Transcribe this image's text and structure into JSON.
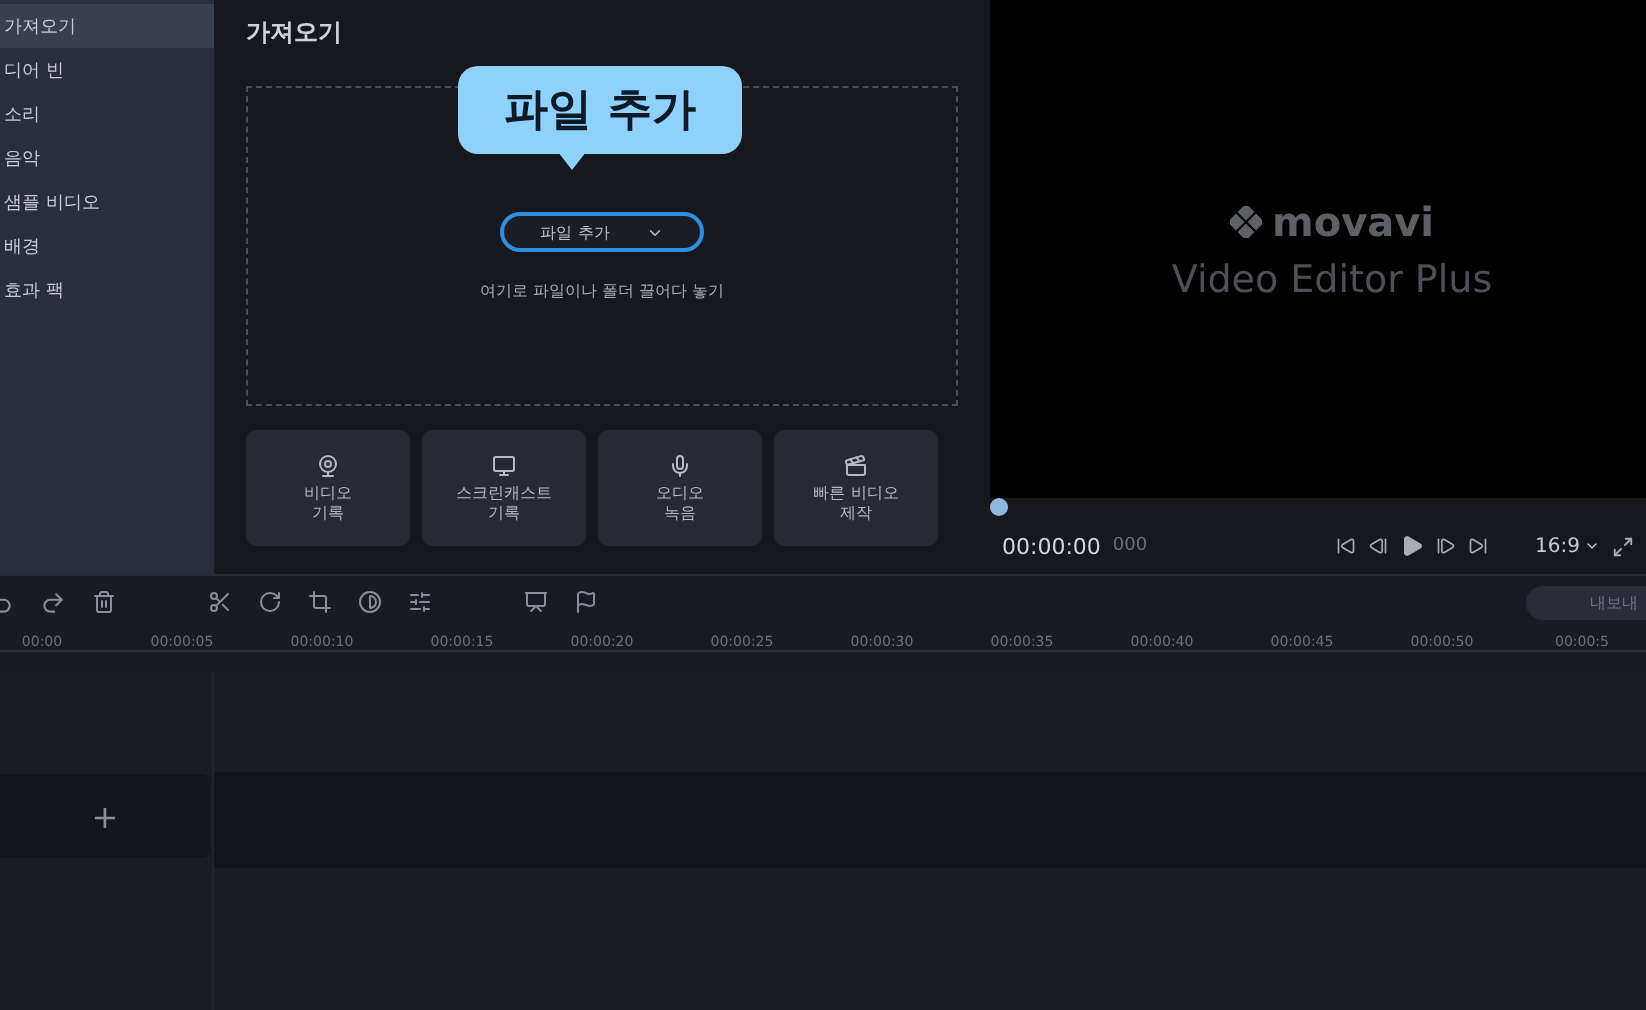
{
  "sidebar": {
    "items": [
      {
        "label": "가져오기",
        "selected": true
      },
      {
        "label": "디어 빈",
        "selected": false
      },
      {
        "label": "소리",
        "selected": false
      },
      {
        "label": "음악",
        "selected": false
      },
      {
        "label": "샘플 비디오",
        "selected": false
      },
      {
        "label": "배경",
        "selected": false
      },
      {
        "label": "효과 팩",
        "selected": false
      }
    ]
  },
  "import_panel": {
    "title": "가져오기",
    "callout": "파일 추가",
    "add_button": "파일 추가",
    "drop_hint": "여기로 파일이나 폴더 끌어다 놓기",
    "actions": [
      {
        "kind": "webcam",
        "lines": [
          "비디오",
          "기록"
        ]
      },
      {
        "kind": "screen",
        "lines": [
          "스크린캐스트",
          "기록"
        ]
      },
      {
        "kind": "mic",
        "lines": [
          "오디오",
          "녹음"
        ]
      },
      {
        "kind": "quick",
        "lines": [
          "빠른 비디오",
          "제작"
        ]
      }
    ]
  },
  "preview": {
    "logo": "movavi",
    "product": "Video Editor Plus",
    "timecode": "00:00:00",
    "milliseconds": "000",
    "aspect": "16:9",
    "level": 0
  },
  "timeline": {
    "export_button": "내보내",
    "ticks": [
      "00:00",
      "00:00:05",
      "00:00:10",
      "00:00:15",
      "00:00:20",
      "00:00:25",
      "00:00:30",
      "00:00:35",
      "00:00:40",
      "00:00:45",
      "00:00:50",
      "00:00:5"
    ],
    "add_track": "+"
  }
}
